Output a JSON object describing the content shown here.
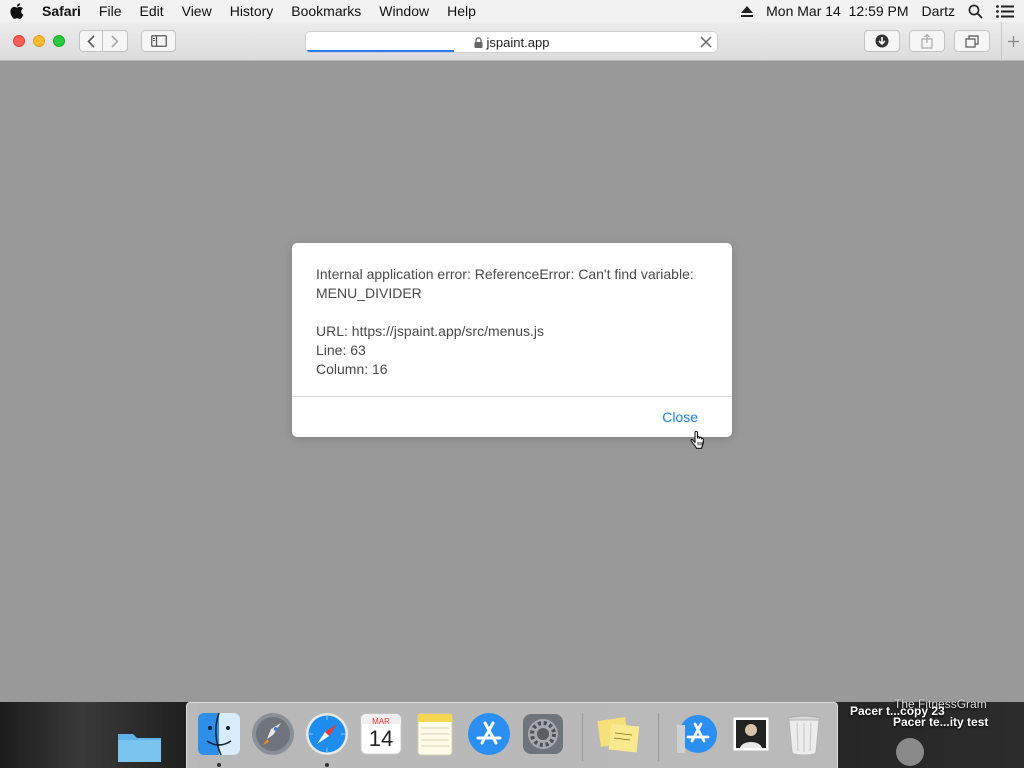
{
  "menubar": {
    "app_name": "Safari",
    "items": [
      "File",
      "Edit",
      "View",
      "History",
      "Bookmarks",
      "Window",
      "Help"
    ],
    "datetime": "Mon Mar 14  12:59 PM",
    "user": "Dartz"
  },
  "browser": {
    "url": "jspaint.app",
    "page_load_progress": 0.36
  },
  "dialog": {
    "error_line1": "Internal application error: ReferenceError: Can't find variable:",
    "error_line2": "MENU_DIVIDER",
    "url_line": "URL: https://jspaint.app/src/menus.js",
    "line_line": "Line: 63",
    "column_line": "Column: 16",
    "close_label": "Close"
  },
  "dock": {
    "calendar_month": "MAR",
    "calendar_day": "14",
    "running_apps": [
      "Finder",
      "Safari"
    ]
  },
  "desktop": {
    "label_top": "The FitnessGram",
    "label_top2": "Pacer t...copy 23",
    "label_bottom": "Pacer te...ity test"
  },
  "colors": {
    "accent": "#1a7fe0",
    "page_background": "#999999"
  }
}
